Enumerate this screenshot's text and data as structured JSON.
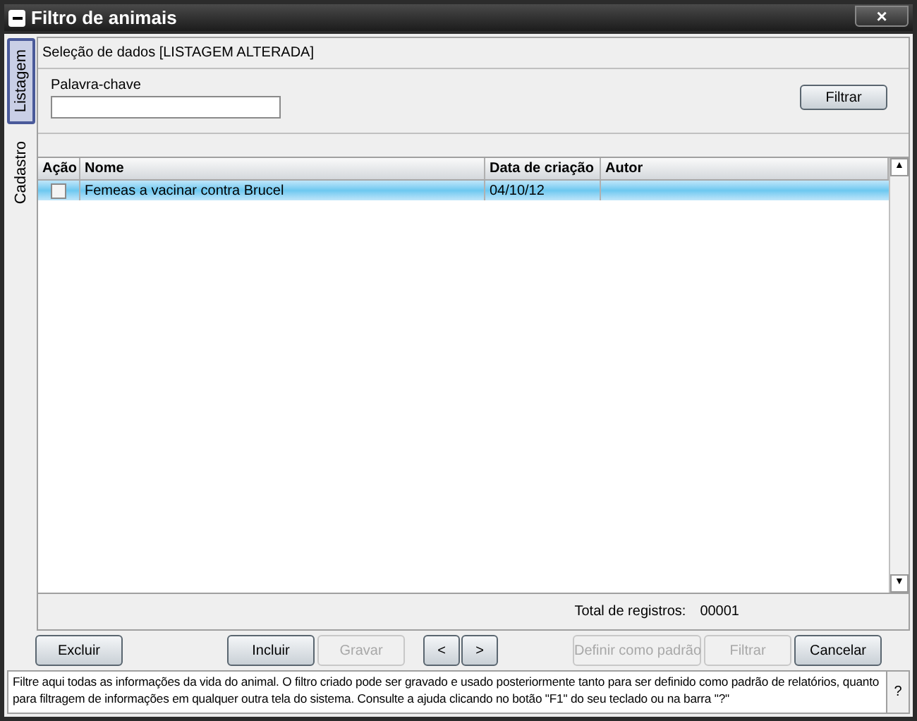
{
  "window": {
    "title": "Filtro de animais"
  },
  "close_button": "×",
  "side_tabs": [
    {
      "label": "Listagem",
      "selected": true
    },
    {
      "label": "Cadastro",
      "selected": false
    }
  ],
  "section_title": "Seleção de dados [LISTAGEM ALTERADA]",
  "keyword": {
    "label": "Palavra-chave"
  },
  "filter_button": "Filtrar",
  "table": {
    "columns": [
      "Ação",
      "Nome",
      "Data de criação",
      "Autor"
    ],
    "rows": [
      {
        "checked": false,
        "selected": true,
        "cells": [
          "",
          "Femeas a vacinar contra Brucel",
          "04/10/12"
        ]
      }
    ]
  },
  "scroll_up": "▲",
  "scroll_down": "▼",
  "total": {
    "label": "Total de registros:",
    "value": "00001"
  },
  "buttons": [
    {
      "label": "Excluir",
      "disabled": false
    },
    {
      "label": "Incluir",
      "disabled": false
    },
    {
      "label": "Gravar",
      "disabled": true
    },
    {
      "label": "<",
      "disabled": false
    },
    {
      "label": ">",
      "disabled": false
    },
    {
      "label": "Definir como padrão",
      "disabled": true
    },
    {
      "label": "Filtrar",
      "disabled": true
    },
    {
      "label": "Cancelar",
      "disabled": false
    }
  ],
  "help_text": "Filtre aqui todas as informações da vida do animal. O filtro criado pode ser gravado e usado posteriormente tanto para ser definido como padrão de relatórios, quanto para filtragem de informações em qualquer outra tela do sistema. Consulte a ajuda clicando no botão \"F1\" do seu teclado ou na barra \"?\"",
  "help_button": "?"
}
